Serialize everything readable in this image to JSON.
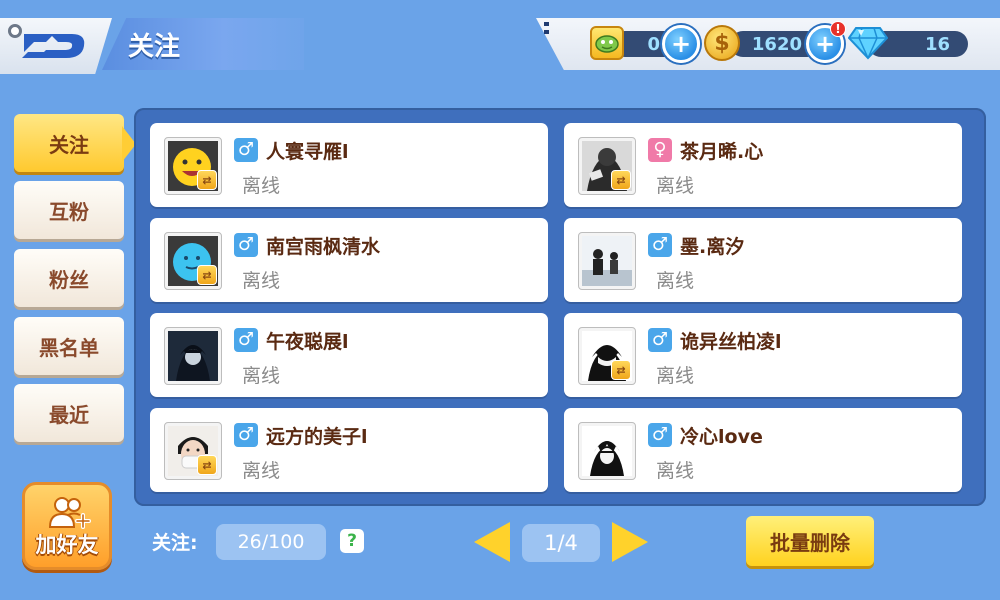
{
  "header": {
    "title": "关注",
    "logo_icon": "game-logo-icon"
  },
  "currency": {
    "ticket": {
      "icon": "green-monster-ticket-icon",
      "value": "0"
    },
    "gold": {
      "icon": "gold-coin-icon",
      "value": "1620",
      "alert": "!"
    },
    "diamond": {
      "icon": "blue-diamond-icon",
      "value": "16"
    },
    "plus_symbol": "+"
  },
  "sidebar": {
    "items": [
      {
        "label": "关注",
        "active": true
      },
      {
        "label": "互粉",
        "active": false
      },
      {
        "label": "粉丝",
        "active": false
      },
      {
        "label": "黑名单",
        "active": false
      },
      {
        "label": "最近",
        "active": false
      }
    ],
    "add_friend_label": "加好友"
  },
  "friends": [
    {
      "name": "人寰寻雁l",
      "status": "离线",
      "gender": "male",
      "gender_symbol": "♂",
      "avatar": "yellow-emoji",
      "mutual": true
    },
    {
      "name": "茶月晞.心",
      "status": "离线",
      "gender": "female",
      "gender_symbol": "♀",
      "avatar": "photo-dark",
      "mutual": true
    },
    {
      "name": "南宫雨枫清水",
      "status": "离线",
      "gender": "male",
      "gender_symbol": "♂",
      "avatar": "blue-emoji",
      "mutual": true
    },
    {
      "name": "墨.离汐",
      "status": "离线",
      "gender": "male",
      "gender_symbol": "♂",
      "avatar": "photo-light",
      "mutual": false
    },
    {
      "name": "午夜聪展l",
      "status": "离线",
      "gender": "male",
      "gender_symbol": "♂",
      "avatar": "anime-dark",
      "mutual": false
    },
    {
      "name": "诡异丝柏凌l",
      "status": "离线",
      "gender": "male",
      "gender_symbol": "♂",
      "avatar": "anime-bw",
      "mutual": true
    },
    {
      "name": "远方的美子l",
      "status": "离线",
      "gender": "male",
      "gender_symbol": "♂",
      "avatar": "photo-mask",
      "mutual": true
    },
    {
      "name": "冷心love",
      "status": "离线",
      "gender": "male",
      "gender_symbol": "♂",
      "avatar": "anime-bw2",
      "mutual": false
    }
  ],
  "mutual_badge_symbol": "⇄",
  "footer": {
    "follow_label": "关注:",
    "follow_count": "26/100",
    "help_symbol": "?",
    "page_indicator": "1/4",
    "batch_delete_label": "批量删除"
  },
  "colors": {
    "background": "#6aa3e8",
    "panel": "#3f6fbd",
    "accent_yellow": "#ffd21f",
    "male": "#4aa6ea",
    "female": "#f07aa8"
  }
}
